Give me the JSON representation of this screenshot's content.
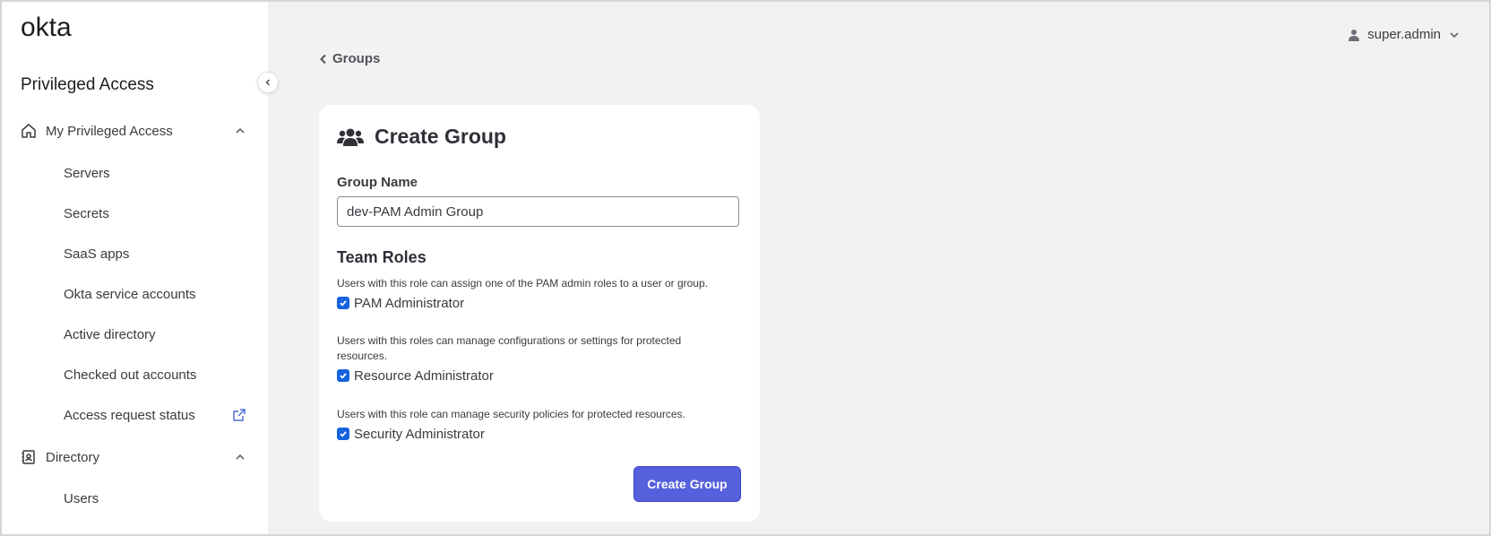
{
  "sidebar": {
    "logo_text": "okta",
    "app_title": "Privileged Access",
    "sections": [
      {
        "label": "My Privileged Access",
        "icon": "home-icon",
        "items": [
          {
            "label": "Servers"
          },
          {
            "label": "Secrets"
          },
          {
            "label": "SaaS apps"
          },
          {
            "label": "Okta service accounts"
          },
          {
            "label": "Active directory"
          },
          {
            "label": "Checked out accounts"
          },
          {
            "label": "Access request status",
            "icon": "external-link-icon"
          }
        ]
      },
      {
        "label": "Directory",
        "icon": "directory-icon",
        "items": [
          {
            "label": "Users"
          }
        ]
      }
    ]
  },
  "header": {
    "user_name": "super.admin"
  },
  "breadcrumb": {
    "label": "Groups"
  },
  "form": {
    "title": "Create Group",
    "group_name_label": "Group Name",
    "group_name_value": "dev-PAM Admin Group",
    "team_roles_title": "Team Roles",
    "roles": [
      {
        "description": "Users with this role can assign one of the PAM admin roles to a user or group.",
        "label": "PAM Administrator",
        "checked": true
      },
      {
        "description": "Users with this roles can manage configurations or settings for protected resources.",
        "label": "Resource Administrator",
        "checked": true
      },
      {
        "description": "Users with this role can manage security policies for protected resources.",
        "label": "Security Administrator",
        "checked": true
      }
    ],
    "submit_label": "Create Group"
  },
  "colors": {
    "primary": "#5660dd",
    "checkbox": "#1662dd",
    "background": "#f2f2f2"
  }
}
